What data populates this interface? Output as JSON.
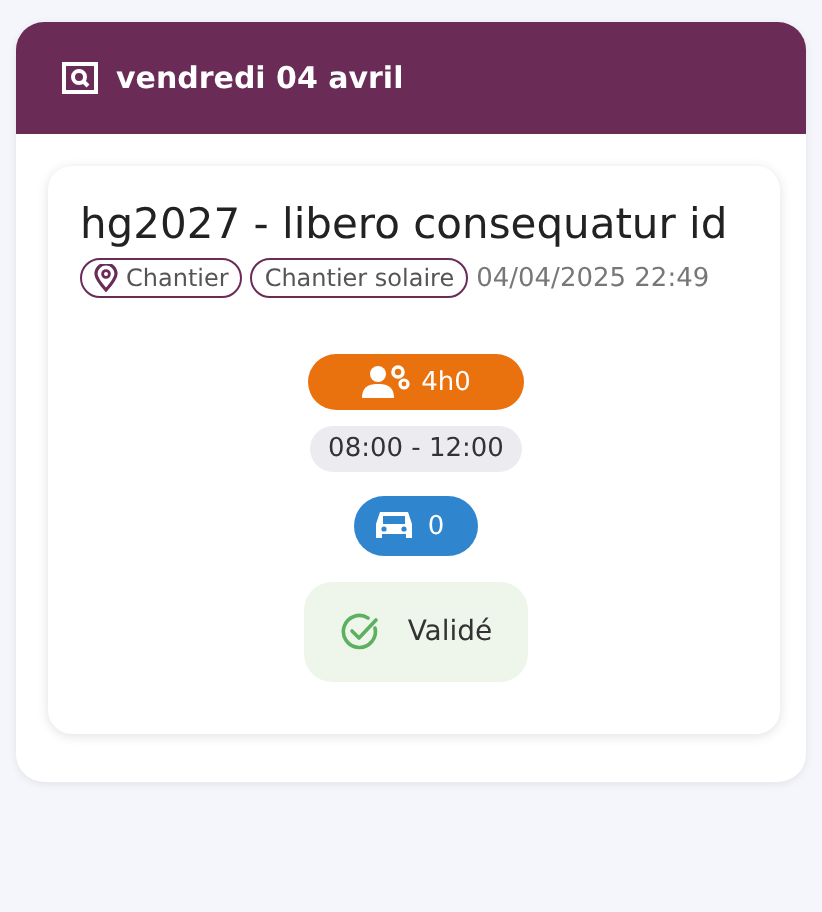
{
  "header": {
    "title": "vendredi 04 avril"
  },
  "entry": {
    "title": "hg2027 - libero consequatur id",
    "tags": [
      {
        "label": "Chantier",
        "kind": "location"
      },
      {
        "label": "Chantier solaire",
        "kind": "plain"
      }
    ],
    "timestamp": "04/04/2025 22:49",
    "duration": "4h0",
    "time_range": "08:00 - 12:00",
    "vehicles": "0",
    "status": {
      "label": "Validé",
      "validated": true
    }
  }
}
